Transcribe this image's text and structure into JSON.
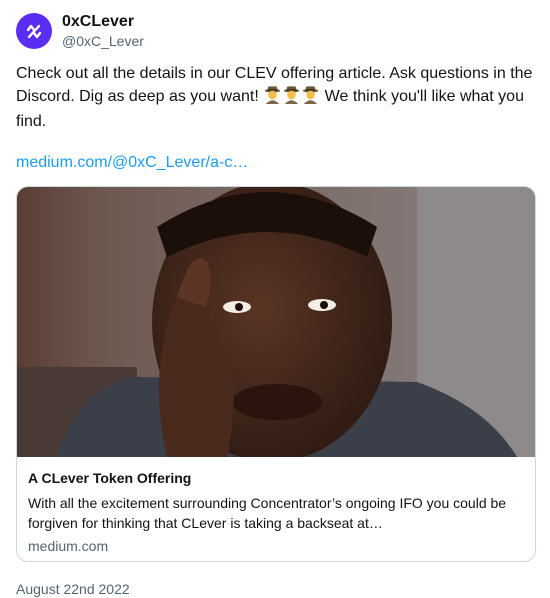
{
  "author": {
    "display_name": "0xCLever",
    "handle": "@0xC_Lever",
    "avatar_icon": "clever-logo-icon",
    "avatar_color": "#5b2cf2"
  },
  "tweet": {
    "text_before": "Check out all the details in our CLEV offering article.  Ask questions in the Discord.  Dig as deep as you want! ",
    "emojis": [
      "detective-emoji",
      "detective-emoji",
      "detective-emoji"
    ],
    "text_after": "  We think you'll like what you find.",
    "link": "medium.com/@0xC_Lever/a-c…",
    "link_color": "#1d9bf0"
  },
  "card": {
    "image_description_icon": "thinking-man-image",
    "title": "A CLever Token Offering",
    "description": "With all the excitement surrounding Concentrator’s ongoing IFO you could be forgiven for thinking that CLever is taking a backseat at…",
    "domain": "medium.com"
  },
  "date": "August 22nd 2022"
}
